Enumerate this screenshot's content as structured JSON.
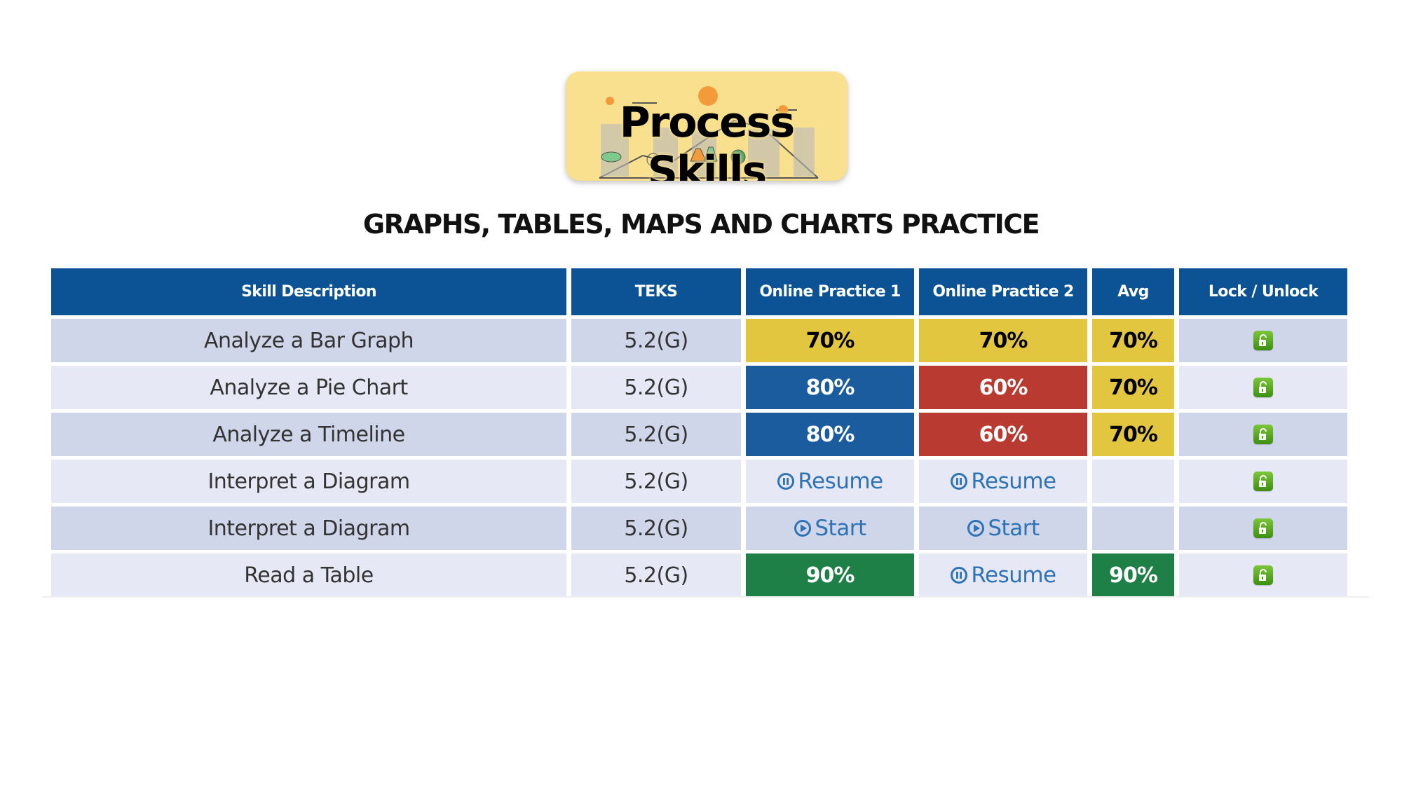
{
  "logo": {
    "text": "Process Skills",
    "icon": "science-doodles-banner"
  },
  "page_title": "GRAPHS, TABLES, MAPS AND CHARTS PRACTICE",
  "colors": {
    "header": "#0b5394",
    "row_dark": "#d0d6ea",
    "row_light": "#e6e9f5",
    "score_yellow": "#e3c63f",
    "score_blue": "#1a5c9e",
    "score_red": "#b83a30",
    "score_green": "#1e8046",
    "link": "#2d73b5",
    "unlock": "#5aab23"
  },
  "table": {
    "headers": [
      "Skill Description",
      "TEKS",
      "Online Practice 1",
      "Online Practice 2",
      "Avg",
      "Lock / Unlock"
    ],
    "rows": [
      {
        "skill": "Analyze a Bar Graph",
        "teks": "5.2(G)",
        "op1": {
          "type": "score",
          "value": "70%",
          "color": "yellow"
        },
        "op2": {
          "type": "score",
          "value": "70%",
          "color": "yellow"
        },
        "avg": {
          "type": "score",
          "value": "70%",
          "color": "yellow"
        },
        "lock": "unlocked"
      },
      {
        "skill": "Analyze a Pie Chart",
        "teks": "5.2(G)",
        "op1": {
          "type": "score",
          "value": "80%",
          "color": "blue"
        },
        "op2": {
          "type": "score",
          "value": "60%",
          "color": "red"
        },
        "avg": {
          "type": "score",
          "value": "70%",
          "color": "yellow"
        },
        "lock": "unlocked"
      },
      {
        "skill": "Analyze a Timeline",
        "teks": "5.2(G)",
        "op1": {
          "type": "score",
          "value": "80%",
          "color": "blue"
        },
        "op2": {
          "type": "score",
          "value": "60%",
          "color": "red"
        },
        "avg": {
          "type": "score",
          "value": "70%",
          "color": "yellow"
        },
        "lock": "unlocked"
      },
      {
        "skill": "Interpret a Diagram",
        "teks": "5.2(G)",
        "op1": {
          "type": "action",
          "label": "Resume",
          "icon": "pause-circle-icon"
        },
        "op2": {
          "type": "action",
          "label": "Resume",
          "icon": "pause-circle-icon"
        },
        "avg": {
          "type": "empty",
          "value": ""
        },
        "lock": "unlocked"
      },
      {
        "skill": "Interpret a Diagram",
        "teks": "5.2(G)",
        "op1": {
          "type": "action",
          "label": "Start",
          "icon": "play-circle-icon"
        },
        "op2": {
          "type": "action",
          "label": "Start",
          "icon": "play-circle-icon"
        },
        "avg": {
          "type": "empty",
          "value": ""
        },
        "lock": "unlocked"
      },
      {
        "skill": "Read a Table",
        "teks": "5.2(G)",
        "op1": {
          "type": "score",
          "value": "90%",
          "color": "green"
        },
        "op2": {
          "type": "action",
          "label": "Resume",
          "icon": "pause-circle-icon"
        },
        "avg": {
          "type": "score",
          "value": "90%",
          "color": "green"
        },
        "lock": "unlocked"
      }
    ]
  }
}
